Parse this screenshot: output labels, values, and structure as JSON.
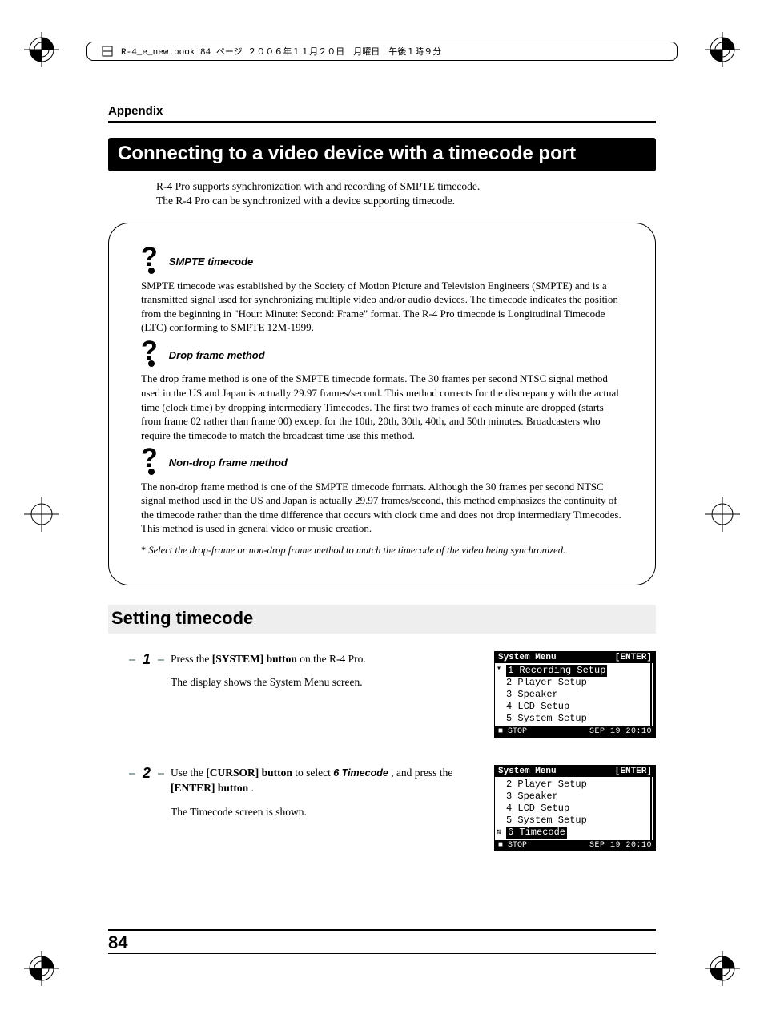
{
  "header": {
    "book_info": "R-4_e_new.book  84 ページ  ２００６年１１月２０日　月曜日　午後１時９分"
  },
  "appendix_label": "Appendix",
  "title": "Connecting to a video device with a timecode port",
  "intro_line1": "R-4 Pro supports synchronization with and recording of SMPTE timecode.",
  "intro_line2": "The R-4 Pro can be synchronized with a device supporting timecode.",
  "info": {
    "smpte": {
      "heading": "SMPTE timecode",
      "body": "SMPTE timecode was established by the Society of Motion Picture and Television Engineers (SMPTE) and is a transmitted signal used for synchronizing multiple video and/or audio devices. The timecode indicates the position from the beginning in \"Hour: Minute: Second: Frame\" format.\nThe R-4 Pro timecode is Longitudinal Timecode (LTC) conforming to SMPTE 12M-1999."
    },
    "drop": {
      "heading": "Drop frame method",
      "body": "The drop frame method is one of the SMPTE timecode formats. The 30 frames per second NTSC signal method used in the US and Japan is actually 29.97 frames/second. This method corrects for the discrepancy with the actual time (clock time) by dropping intermediary Timecodes. The first two frames of each minute are dropped (starts from frame 02 rather than frame 00) except for the 10th, 20th, 30th, 40th, and 50th minutes. Broadcasters who require the timecode to match the broadcast time use this method."
    },
    "nondrop": {
      "heading": "Non-drop frame method",
      "body": "The non-drop frame method is one of the SMPTE timecode formats. Although the 30 frames per second NTSC signal method used in the US and Japan is actually 29.97 frames/second, this method emphasizes the continuity of the timecode rather than the time difference that occurs with clock time and does not drop intermediary Timecodes. This method is used in general video or music creation."
    },
    "note": "Select the drop-frame or non-drop frame method to match the timecode of the video being synchronized."
  },
  "section_heading": "Setting timecode",
  "steps": {
    "s1": {
      "num": "1",
      "t_pre": "Press the ",
      "t_bold": "[SYSTEM] button",
      "t_post": " on the R-4 Pro.",
      "t_sub": "The display shows the System Menu screen."
    },
    "s2": {
      "num": "2",
      "t_pre": "Use the ",
      "t_bold1": "[CURSOR] button",
      "t_mid": " to select ",
      "t_ital": "6 Timecode",
      "t_mid2": ", and press the ",
      "t_bold2": "[ENTER] button",
      "t_post": ".",
      "t_sub": "The Timecode screen is shown."
    }
  },
  "lcd1": {
    "title": "System Menu",
    "enter": "[ENTER]",
    "rows": [
      "1 Recording Setup",
      "2 Player Setup",
      "3 Speaker",
      "4 LCD Setup",
      "5 System Setup"
    ],
    "highlight_index": 0,
    "status_l": "■ STOP",
    "status_r": "SEP 19 20:10"
  },
  "lcd2": {
    "title": "System Menu",
    "enter": "[ENTER]",
    "rows": [
      "2 Player Setup",
      "3 Speaker",
      "4 LCD Setup",
      "5 System Setup",
      "6 Timecode"
    ],
    "highlight_index": 4,
    "status_l": "■ STOP",
    "status_r": "SEP 19 20:10"
  },
  "page_number": "84"
}
